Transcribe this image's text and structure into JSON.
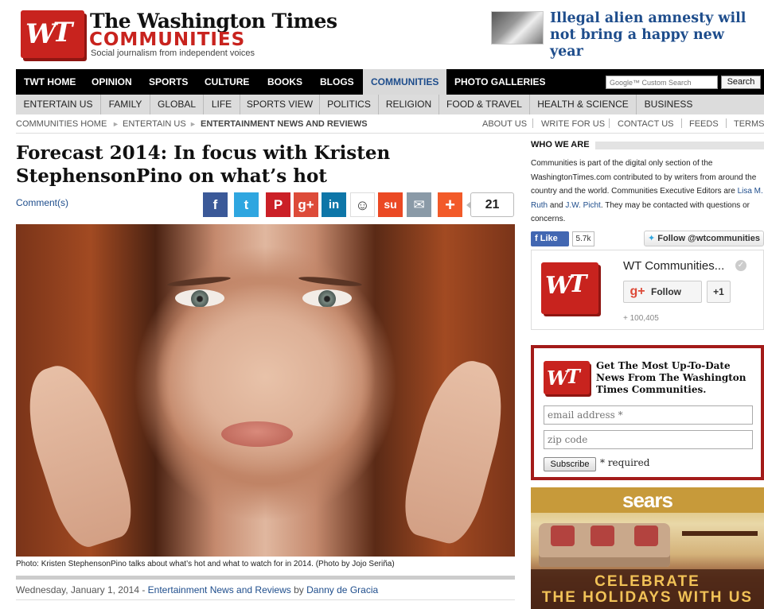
{
  "header": {
    "logo_letters": [
      "W",
      "T"
    ],
    "masthead": "The Washington Times",
    "section": "COMMUNITIES",
    "tagline": "Social journalism from independent voices",
    "promo_headline": "Illegal alien amnesty will not bring a happy new year"
  },
  "main_nav": {
    "items": [
      "TWT HOME",
      "OPINION",
      "SPORTS",
      "CULTURE",
      "BOOKS",
      "BLOGS",
      "COMMUNITIES",
      "PHOTO GALLERIES"
    ],
    "active": "COMMUNITIES",
    "search_placeholder": "Google™ Custom Search",
    "search_button": "Search"
  },
  "sub_nav": {
    "items": [
      "ENTERTAIN US",
      "FAMILY",
      "GLOBAL",
      "LIFE",
      "SPORTS VIEW",
      "POLITICS",
      "RELIGION",
      "FOOD & TRAVEL",
      "HEALTH & SCIENCE",
      "BUSINESS"
    ]
  },
  "breadcrumb": {
    "items": [
      "COMMUNITIES HOME",
      "ENTERTAIN US",
      "ENTERTAINMENT NEWS AND REVIEWS"
    ],
    "separator": "►"
  },
  "utility_links": [
    "ABOUT US",
    "WRITE FOR US",
    "CONTACT US",
    "FEEDS",
    "TERMS"
  ],
  "article": {
    "headline": "Forecast 2014: In focus with Kristen StephensonPino on what’s hot",
    "comments_label": "Comment(s)",
    "share_buttons": [
      {
        "icon": "facebook-icon",
        "glyph": "f",
        "color": "#3b5998"
      },
      {
        "icon": "twitter-icon",
        "glyph": "t",
        "color": "#2fa6e0"
      },
      {
        "icon": "pinterest-icon",
        "glyph": "P",
        "color": "#cb2027"
      },
      {
        "icon": "google-plus-icon",
        "glyph": "g+",
        "color": "#dd4b39"
      },
      {
        "icon": "linkedin-icon",
        "glyph": "in",
        "color": "#0e76a8"
      },
      {
        "icon": "reddit-icon",
        "glyph": "☺",
        "color": "#ffffff"
      },
      {
        "icon": "stumbleupon-icon",
        "glyph": "su",
        "color": "#eb4924"
      },
      {
        "icon": "email-icon",
        "glyph": "✉",
        "color": "#8a9aa7"
      },
      {
        "icon": "more-share-icon",
        "glyph": "+",
        "color": "#f25a29"
      }
    ],
    "share_count": "21",
    "photo_caption": "Photo: Kristen StephensonPino talks about what’s hot and what to watch for in 2014. (Photo by Jojo Seriña)",
    "byline_date": "Wednesday, January 1, 2014",
    "byline_separator": " - ",
    "byline_category": "Entertainment News and Reviews",
    "byline_by": " by ",
    "byline_author": "Danny de Gracia"
  },
  "sidebar": {
    "who_heading": "WHO WE ARE",
    "who_text_1": "Communities is part of the digital only section of the WashingtonTimes.com contributed to by writers from around the country and the world. Communities Executive Editors are ",
    "who_link_1": "Lisa M. Ruth",
    "who_and": " and ",
    "who_link_2": "J.W. Picht",
    "who_text_2": ". They may be contacted with questions or concerns.",
    "fb_like": "Like",
    "fb_count": "5.7k",
    "twitter_follow": "Follow @wtcommunities",
    "gplus": {
      "name": "WT Communities...",
      "follow": "Follow",
      "plus_one": "+1",
      "count": "+ 100,405"
    },
    "signup": {
      "title": "Get The Most Up-To-Date News From The Washington Times Communities.",
      "email_placeholder": "email address *",
      "zip_placeholder": "zip code",
      "button": "Subscribe",
      "required_note": "* required"
    },
    "ad": {
      "brand": "sears",
      "line1": "CELEBRATE",
      "line2": "THE HOLIDAYS WITH US"
    }
  }
}
